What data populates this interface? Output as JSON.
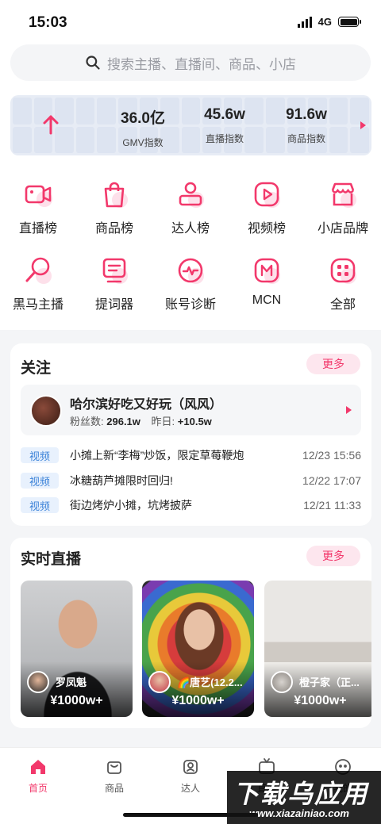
{
  "status": {
    "time": "15:03",
    "network": "4G"
  },
  "search": {
    "placeholder": "搜索主播、直播间、商品、小店"
  },
  "stats": [
    {
      "value": "36.0亿",
      "label": "GMV指数"
    },
    {
      "value": "45.6w",
      "label": "直播指数"
    },
    {
      "value": "91.6w",
      "label": "商品指数"
    }
  ],
  "menu": [
    {
      "label": "直播榜",
      "icon": "camera-icon"
    },
    {
      "label": "商品榜",
      "icon": "shopping-bag-icon"
    },
    {
      "label": "达人榜",
      "icon": "person-icon"
    },
    {
      "label": "视频榜",
      "icon": "play-icon"
    },
    {
      "label": "小店品牌",
      "icon": "store-icon"
    },
    {
      "label": "黑马主播",
      "icon": "magnifier-icon"
    },
    {
      "label": "提词器",
      "icon": "teleprompter-icon"
    },
    {
      "label": "账号诊断",
      "icon": "pulse-icon"
    },
    {
      "label": "MCN",
      "icon": "mcn-icon"
    },
    {
      "label": "全部",
      "icon": "grid-icon"
    }
  ],
  "follow": {
    "title": "关注",
    "more": "更多",
    "user": {
      "name": "哈尔滨好吃又好玩（风风）",
      "fans_label": "粉丝数:",
      "fans": "296.1w",
      "yesterday_label": "昨日:",
      "yesterday": "+10.5w"
    },
    "videos": [
      {
        "tag": "视频",
        "title": "小摊上新“李梅”炒饭，限定草莓鞭炮",
        "time": "12/23 15:56"
      },
      {
        "tag": "视频",
        "title": "冰糖葫芦摊限时回归!",
        "time": "12/22 17:07"
      },
      {
        "tag": "视频",
        "title": "街边烤炉小摊，坑烤披萨",
        "time": "12/21 11:33"
      }
    ]
  },
  "live": {
    "title": "实时直播",
    "more": "更多",
    "items": [
      {
        "name": "罗凤魁",
        "value": "¥1000w+"
      },
      {
        "name": "🌈唐艺(12.2...",
        "value": "¥1000w+"
      },
      {
        "name": "橙子家（正...",
        "value": "¥1000w+"
      }
    ]
  },
  "tabs": [
    {
      "label": "首页",
      "icon": "home-icon",
      "active": true
    },
    {
      "label": "商品",
      "icon": "bag-icon"
    },
    {
      "label": "达人",
      "icon": "person-card-icon"
    },
    {
      "label": "直播",
      "icon": "tv-icon"
    },
    {
      "label": "我的",
      "icon": "face-icon"
    }
  ],
  "watermark": {
    "main": "下载乌应用",
    "sub": "www.xiazainiao.com"
  },
  "colors": {
    "accent": "#f2386b",
    "tag_bg": "#e8f1fd",
    "tag_text": "#3b82d8"
  }
}
